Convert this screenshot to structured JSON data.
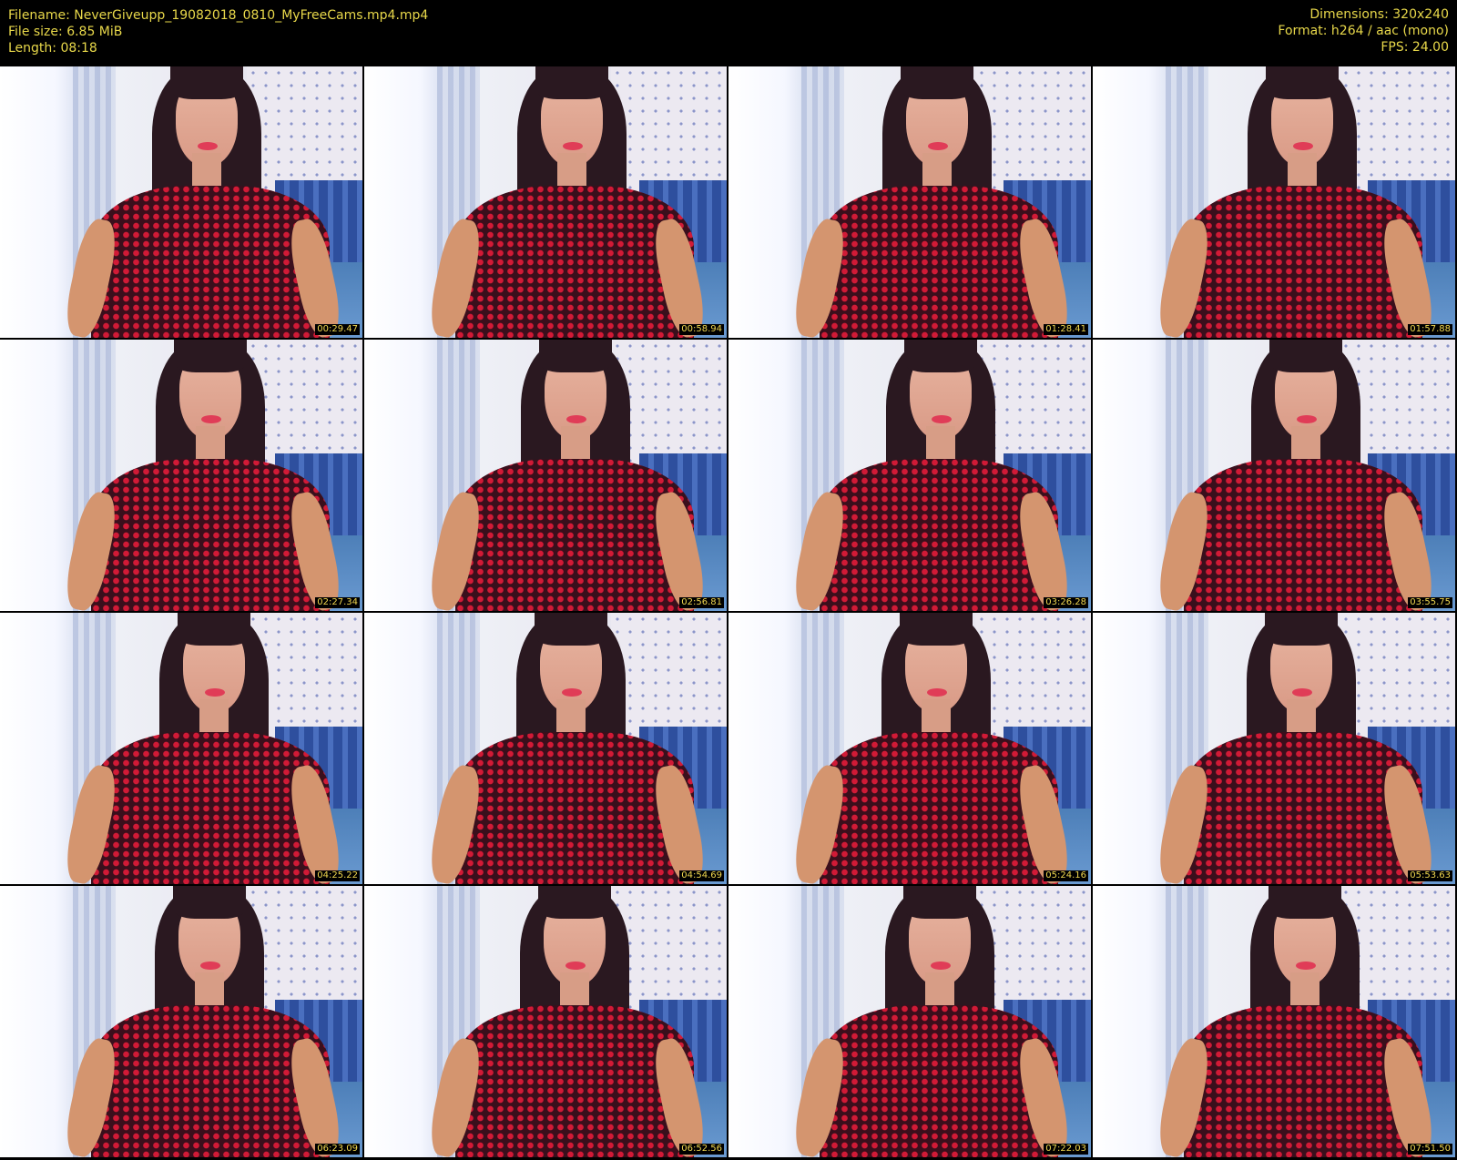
{
  "header": {
    "filename_label": "Filename: NeverGiveupp_19082018_0810_MyFreeCams.mp4.mp4",
    "filesize_label": "File size: 6.85 MiB",
    "length_label": "Length: 08:18",
    "dimensions_label": "Dimensions: 320x240",
    "format_label": "Format: h264 / aac (mono)",
    "fps_label": "FPS: 24.00"
  },
  "thumbnails": [
    {
      "timestamp": "00:29.47"
    },
    {
      "timestamp": "00:58.94"
    },
    {
      "timestamp": "01:28.41"
    },
    {
      "timestamp": "01:57.88"
    },
    {
      "timestamp": "02:27.34"
    },
    {
      "timestamp": "02:56.81"
    },
    {
      "timestamp": "03:26.28"
    },
    {
      "timestamp": "03:55.75"
    },
    {
      "timestamp": "04:25.22"
    },
    {
      "timestamp": "04:54.69"
    },
    {
      "timestamp": "05:24.16"
    },
    {
      "timestamp": "05:53.63"
    },
    {
      "timestamp": "06:23.09"
    },
    {
      "timestamp": "06:52.56"
    },
    {
      "timestamp": "07:22.03"
    },
    {
      "timestamp": "07:51.50"
    }
  ],
  "colors": {
    "header_text": "#e8d84a",
    "background": "#000000",
    "timestamp_text": "#f1d850"
  }
}
